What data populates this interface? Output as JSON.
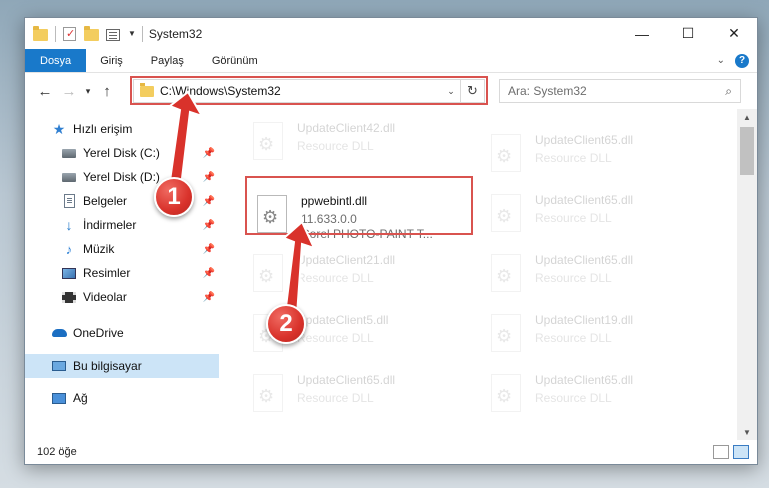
{
  "titlebar": {
    "title": "System32",
    "minimize_glyph": "—",
    "maximize_glyph": "☐",
    "close_glyph": "✕"
  },
  "ribbon": {
    "tabs": [
      "Dosya",
      "Giriş",
      "Paylaş",
      "Görünüm"
    ],
    "help_glyph": "?"
  },
  "nav": {
    "address": "C:\\Windows\\System32",
    "search_placeholder": "Ara: System32"
  },
  "sidebar": {
    "items": [
      {
        "label": "Hızlı erişim",
        "icon": "star-icon",
        "pinned": false
      },
      {
        "label": "Yerel Disk (C:)",
        "icon": "disk-icon",
        "pinned": true
      },
      {
        "label": "Yerel Disk (D:)",
        "icon": "disk-icon",
        "pinned": true
      },
      {
        "label": "Belgeler",
        "icon": "documents-icon",
        "pinned": true
      },
      {
        "label": "İndirmeler",
        "icon": "downloads-icon",
        "pinned": true
      },
      {
        "label": "Müzik",
        "icon": "music-icon",
        "pinned": true
      },
      {
        "label": "Resimler",
        "icon": "pictures-icon",
        "pinned": true
      },
      {
        "label": "Videolar",
        "icon": "videos-icon",
        "pinned": true
      },
      {
        "label": "OneDrive",
        "icon": "onedrive-icon",
        "pinned": false
      },
      {
        "label": "Bu bilgisayar",
        "icon": "computer-icon",
        "pinned": false,
        "selected": true
      },
      {
        "label": "Ağ",
        "icon": "network-icon",
        "pinned": false
      }
    ]
  },
  "files": {
    "highlighted": {
      "name": "ppwebintl.dll",
      "version": "11.633.0.0",
      "description": "Corel PHOTO-PAINT T..."
    },
    "left_column": [
      {
        "name": "UpdateClient42.dll",
        "type": "Resource DLL"
      },
      {
        "name": "UpdateClient21.dll",
        "type": "Resource DLL"
      },
      {
        "name": "UpdateClient5.dll",
        "type": "Resource DLL"
      },
      {
        "name": "UpdateClient65.dll",
        "type": "Resource DLL"
      }
    ],
    "right_column": [
      {
        "name": "UpdateClient65.dll",
        "type": "Resource DLL"
      },
      {
        "name": "UpdateClient65.dll",
        "type": "Resource DLL"
      },
      {
        "name": "UpdateClient65.dll",
        "type": "Resource DLL"
      },
      {
        "name": "UpdateClient19.dll",
        "type": "Resource DLL"
      },
      {
        "name": "UpdateClient65.dll",
        "type": "Resource DLL"
      }
    ]
  },
  "status": {
    "item_count": "102 öğe"
  },
  "callouts": {
    "step1": "1",
    "step2": "2",
    "color": "#d9322b"
  },
  "colors": {
    "accent": "#1979ca",
    "highlight": "#d9534f",
    "selection": "#cce4f7"
  }
}
